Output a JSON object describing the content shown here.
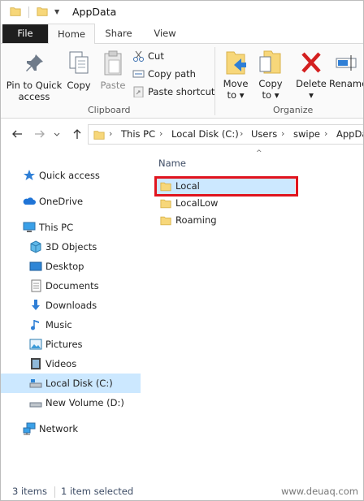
{
  "window": {
    "title": "AppData"
  },
  "tabs": [
    {
      "label": "File"
    },
    {
      "label": "Home"
    },
    {
      "label": "Share"
    },
    {
      "label": "View"
    }
  ],
  "ribbon": {
    "pin_label_1": "Pin to Quick",
    "pin_label_2": "access",
    "copy_label": "Copy",
    "paste_label": "Paste",
    "cut_label": "Cut",
    "copy_path_label": "Copy path",
    "paste_shortcut_label": "Paste shortcut",
    "clipboard_group": "Clipboard",
    "move_to_label_1": "Move",
    "move_to_label_2": "to",
    "copy_to_label_1": "Copy",
    "copy_to_label_2": "to",
    "delete_label": "Delete",
    "rename_label": "Rename",
    "organize_group": "Organize"
  },
  "address": {
    "segments": [
      "This PC",
      "Local Disk (C:)",
      "Users",
      "swipe",
      "AppData"
    ]
  },
  "nav": {
    "quick_access": "Quick access",
    "onedrive": "OneDrive",
    "this_pc": "This PC",
    "items": [
      {
        "label": "3D Objects",
        "icon": "3d-objects-icon"
      },
      {
        "label": "Desktop",
        "icon": "desktop-icon"
      },
      {
        "label": "Documents",
        "icon": "documents-icon"
      },
      {
        "label": "Downloads",
        "icon": "downloads-icon"
      },
      {
        "label": "Music",
        "icon": "music-icon"
      },
      {
        "label": "Pictures",
        "icon": "pictures-icon"
      },
      {
        "label": "Videos",
        "icon": "videos-icon"
      },
      {
        "label": "Local Disk (C:)",
        "icon": "drive-icon"
      },
      {
        "label": "New Volume (D:)",
        "icon": "drive-icon"
      }
    ],
    "network": "Network"
  },
  "content": {
    "column_header": "Name",
    "files": [
      {
        "name": "Local",
        "selected": true
      },
      {
        "name": "LocalLow",
        "selected": false
      },
      {
        "name": "Roaming",
        "selected": false
      }
    ]
  },
  "status": {
    "count": "3 items",
    "selection": "1 item selected",
    "watermark": "www.deuaq.com"
  },
  "colors": {
    "selection": "#cce8ff",
    "folder": "#f7d77a",
    "highlight": "#e0141e",
    "file_tab": "#1e1e1e"
  }
}
